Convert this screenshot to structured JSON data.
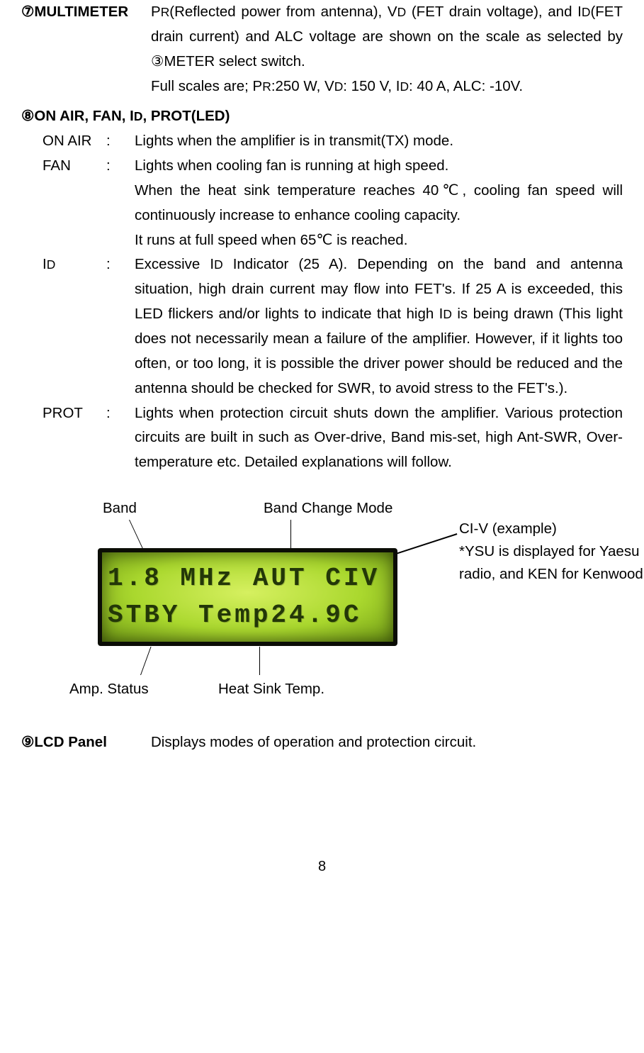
{
  "item7": {
    "label": "⑦MULTIMETER",
    "p1_a": "P",
    "p1_b": "R",
    "p1_c": "(Reflected power from antenna), V",
    "p1_d": "D",
    "p1_e": " (FET drain voltage), and I",
    "p1_f": "D",
    "p1_g": "(FET drain current) and ALC voltage are shown on the scale as selected by  ③METER select switch.",
    "p2_a": "Full scales are; P",
    "p2_b": "R",
    "p2_c": ":250 W, V",
    "p2_d": "D",
    "p2_e": ": 150 V, I",
    "p2_f": "D",
    "p2_g": ": 40 A, ALC: -10V."
  },
  "item8": {
    "heading_a": "⑧ON AIR, FAN, I",
    "heading_b": "D",
    "heading_c": ", PROT(LED)",
    "onair": {
      "key": "ON AIR",
      "colon": ":",
      "body": "Lights when the amplifier is in transmit(TX) mode."
    },
    "fan": {
      "key": "FAN",
      "colon": ":",
      "p1": "Lights when cooling fan is running at high speed.",
      "p2": "When the heat sink temperature reaches 40℃, cooling fan speed will continuously increase to enhance cooling capacity.",
      "p3": "It runs at full speed when 65℃ is reached."
    },
    "id": {
      "key_a": "I",
      "key_b": "D",
      "colon": ":",
      "body_a": "Excessive I",
      "body_b": "D",
      "body_c": " Indicator (25 A). Depending on the band and antenna situation, high drain current may flow into FET's. If 25 A is exceeded, this LED flickers and/or lights to indicate that high I",
      "body_d": "D",
      "body_e": " is being drawn (This light does not necessarily mean a failure of the amplifier. However, if it lights too often, or too long, it is possible the driver power should be reduced and the antenna should be checked for SWR, to avoid stress to the FET's.)."
    },
    "prot": {
      "key": "PROT",
      "colon": ":",
      "body": "Lights when protection circuit shuts down the amplifier. Various protection circuits are built in such as Over-drive, Band mis-set, high Ant-SWR, Over-temperature etc. Detailed explanations will follow."
    }
  },
  "diagram": {
    "band": "Band",
    "bcm": "Band Change Mode",
    "civ": "CI-V (example)",
    "note": "*YSU is displayed for Yaesu radio, and KEN for Kenwood's.",
    "lcd_line1": "1.8 MHz AUT CIV",
    "lcd_line2": "STBY Temp24.9C",
    "amp": "Amp. Status",
    "hst": "Heat Sink Temp."
  },
  "item9": {
    "label": "⑨LCD Panel",
    "body": "Displays modes of operation and protection circuit."
  },
  "page": "8"
}
